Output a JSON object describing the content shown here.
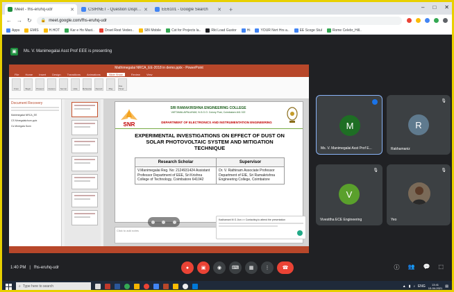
{
  "browser": {
    "tabs": [
      {
        "label": "Meet - fhs-eruhq-udr",
        "color": "#1e8e3e",
        "active": true
      },
      {
        "label": "CSIRNET - Question Display Tools",
        "color": "#4285f4",
        "active": false
      },
      {
        "label": "EE6101 - Google Search",
        "color": "#4285f4",
        "active": false
      }
    ],
    "new_tab": "+",
    "window_controls": [
      "–",
      "□",
      "✕"
    ],
    "url": "meet.google.com/fhs-eruhq-udr",
    "bookmarks": [
      "Apps",
      "EMIS",
      "H.HOT",
      "Kar e Ho Mast..",
      "Drset Rest Vedeo..",
      "SBI Mobile",
      "Cst for Projects la..",
      "Rkt Load Gustor",
      "Hi",
      "YOUR Nvrt Hrs a..",
      "EE Scoge Stul",
      "Rome Celebr_Hill.."
    ]
  },
  "meet": {
    "presenting_text": "Ms. V. Manimegalai Asst Prof EEE is presenting",
    "meeting_time": "1:40 PM",
    "meeting_code": "fhs-eruhq-udr",
    "participants": [
      {
        "initial": "M",
        "name": "Ms. V. Manimegalai Asst Prof E...",
        "color": "#1e6e24",
        "muted": false
      },
      {
        "initial": "R",
        "name": "Rakhamaniz",
        "color": "#5f7a8e",
        "muted": true
      },
      {
        "initial": "V",
        "name": "Vivesttha ECE Engineering",
        "color": "#5aa02c",
        "muted": true
      },
      {
        "initial": "",
        "name": "Yeo",
        "color": "#6a5a4a",
        "muted": true
      }
    ],
    "mute_icon": "🎙",
    "control_glyphs": [
      "●",
      "▣",
      "◉",
      "⌨",
      "▦",
      "⋮",
      "☎"
    ],
    "right_glyphs": [
      "ⓘ",
      "👥",
      "💬",
      "⬚"
    ]
  },
  "powerpoint": {
    "window_title": "Mathimegalai NRCA_EE-2018 in demo.pptx - PowerPoint",
    "ribbon_tabs": [
      "File",
      "Home",
      "Insert",
      "Design",
      "Transitions",
      "Animations",
      "Slide Show",
      "Review",
      "View"
    ],
    "active_tab": "Slide Show",
    "ribbon_buttons": [
      "From",
      "Begin",
      "Present",
      "Custom",
      "Set Up",
      "Hide",
      "Rehearse",
      "Record",
      "Play",
      "Use Timer"
    ],
    "pane_title": "Document Recovery",
    "pane_items": [
      "Mahimegalai NRCA_EE",
      "CS Mnregalaichum.pptx",
      "Cs Mnregala Sunn"
    ],
    "notes_placeholder": "Click to add notes",
    "slide": {
      "college": "SRI RAMAKRISHNA ENGINEERING COLLEGE",
      "college_address": "VATTAMALAIPALAYAM, N.G.G.O. Colony Post, Coimbatore-641 022",
      "department": "DEPARTMENT OF ELECTRONICS AND INSTRUMENTATION ENGINEERING",
      "logo_text": "SNR",
      "title": "EXPERIMENTAL INVESTIGATIONS ON EFFECT OF DUST ON SOLAR PHOTOVOLTAIC SYSTEM AND MITIGATION TECHNIQUE",
      "col_scholar": "Research Scholar",
      "col_supervisor": "Supervisor",
      "scholar_details": "V.Manimegalai Reg. No: 2124931424 Assistant Professor Department of EEE, Sri Krishna College of Technology, Coimbatore 641042",
      "supervisor_details": "Dr. V. Rathinam Associate Professor Department of EIE, Sri Ramakrishna Engineering College, Coimbatore"
    }
  },
  "toast_text": "Kadhamani M G Jion >> Contacting to attend the presentation",
  "taskbar": {
    "search_placeholder": "Type here to search",
    "time": "13:41",
    "date": "10-04-2021",
    "tray_text": "ENG"
  }
}
